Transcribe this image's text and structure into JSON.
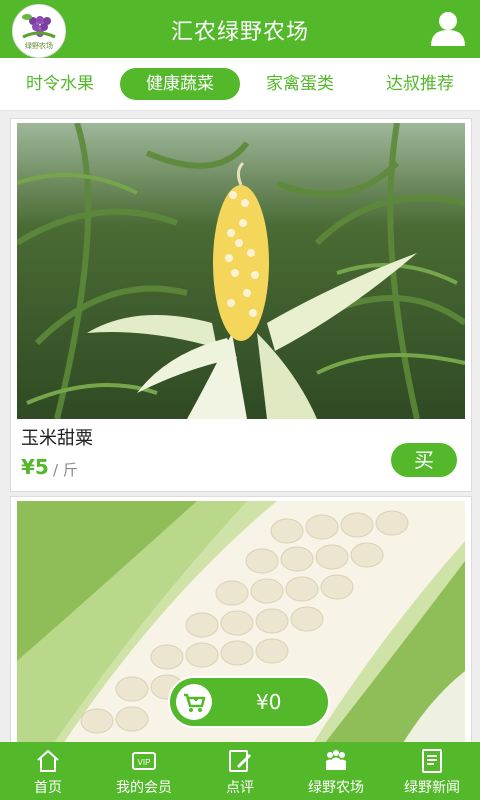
{
  "header": {
    "title": "汇农绿野农场",
    "logo_text": "绿野农场"
  },
  "tabs": [
    {
      "label": "时令水果"
    },
    {
      "label": "健康蔬菜"
    },
    {
      "label": "家禽蛋类"
    },
    {
      "label": "达叔推荐"
    }
  ],
  "products": [
    {
      "name": "玉米甜粟",
      "price": "¥5",
      "unit": "/ 斤",
      "buy_label": "买"
    }
  ],
  "cart": {
    "total": "¥0"
  },
  "footer": {
    "items": [
      {
        "label": "首页",
        "icon": "home-icon"
      },
      {
        "label": "我的会员",
        "icon": "vip-icon"
      },
      {
        "label": "点评",
        "icon": "review-icon"
      },
      {
        "label": "绿野农场",
        "icon": "people-icon"
      },
      {
        "label": "绿野新闻",
        "icon": "news-icon"
      }
    ]
  },
  "colors": {
    "accent": "#53b82a"
  }
}
